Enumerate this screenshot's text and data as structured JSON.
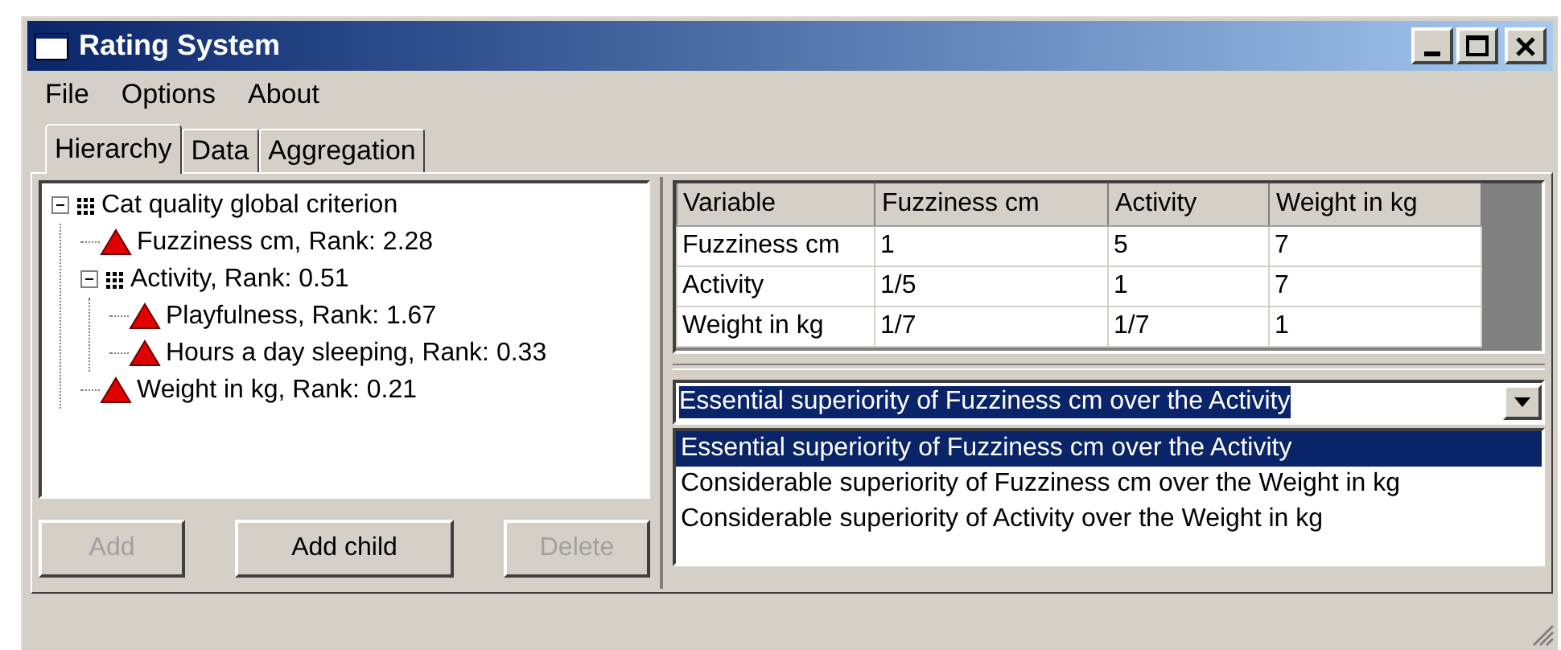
{
  "window": {
    "title": "Rating System"
  },
  "menu": [
    "File",
    "Options",
    "About"
  ],
  "tabs": [
    {
      "label": "Hierarchy",
      "selected": true
    },
    {
      "label": "Data",
      "selected": false
    },
    {
      "label": "Aggregation",
      "selected": false
    }
  ],
  "tree": [
    {
      "label": "Cat quality global criterion",
      "kind": "group",
      "expanded": true,
      "children": [
        {
          "label": "Fuzziness cm, Rank: 2.28",
          "kind": "criterion"
        },
        {
          "label": "Activity, Rank: 0.51",
          "kind": "group",
          "expanded": true,
          "children": [
            {
              "label": "Playfulness, Rank: 1.67",
              "kind": "criterion"
            },
            {
              "label": "Hours a day sleeping, Rank: 0.33",
              "kind": "criterion"
            }
          ]
        },
        {
          "label": "Weight in kg, Rank: 0.21",
          "kind": "criterion"
        }
      ]
    }
  ],
  "buttons": [
    {
      "label": "Add",
      "disabled": true
    },
    {
      "label": "Add child",
      "disabled": false
    },
    {
      "label": "Delete",
      "disabled": true
    }
  ],
  "table": {
    "columns": [
      "Variable",
      "Fuzziness cm",
      "Activity",
      "Weight in kg"
    ],
    "rows": [
      [
        "Fuzziness cm",
        "1",
        "5",
        "7"
      ],
      [
        "Activity",
        "1/5",
        "1",
        "7"
      ],
      [
        "Weight in kg",
        "1/7",
        "1/7",
        "1"
      ]
    ]
  },
  "combo": {
    "value": "Essential superiority of Fuzziness cm over the Activity"
  },
  "list": [
    {
      "label": "Essential superiority of Fuzziness cm over the Activity",
      "selected": true
    },
    {
      "label": "Considerable superiority of Fuzziness cm over the Weight in kg",
      "selected": false
    },
    {
      "label": "Considerable superiority of Activity over the Weight in kg",
      "selected": false
    }
  ]
}
